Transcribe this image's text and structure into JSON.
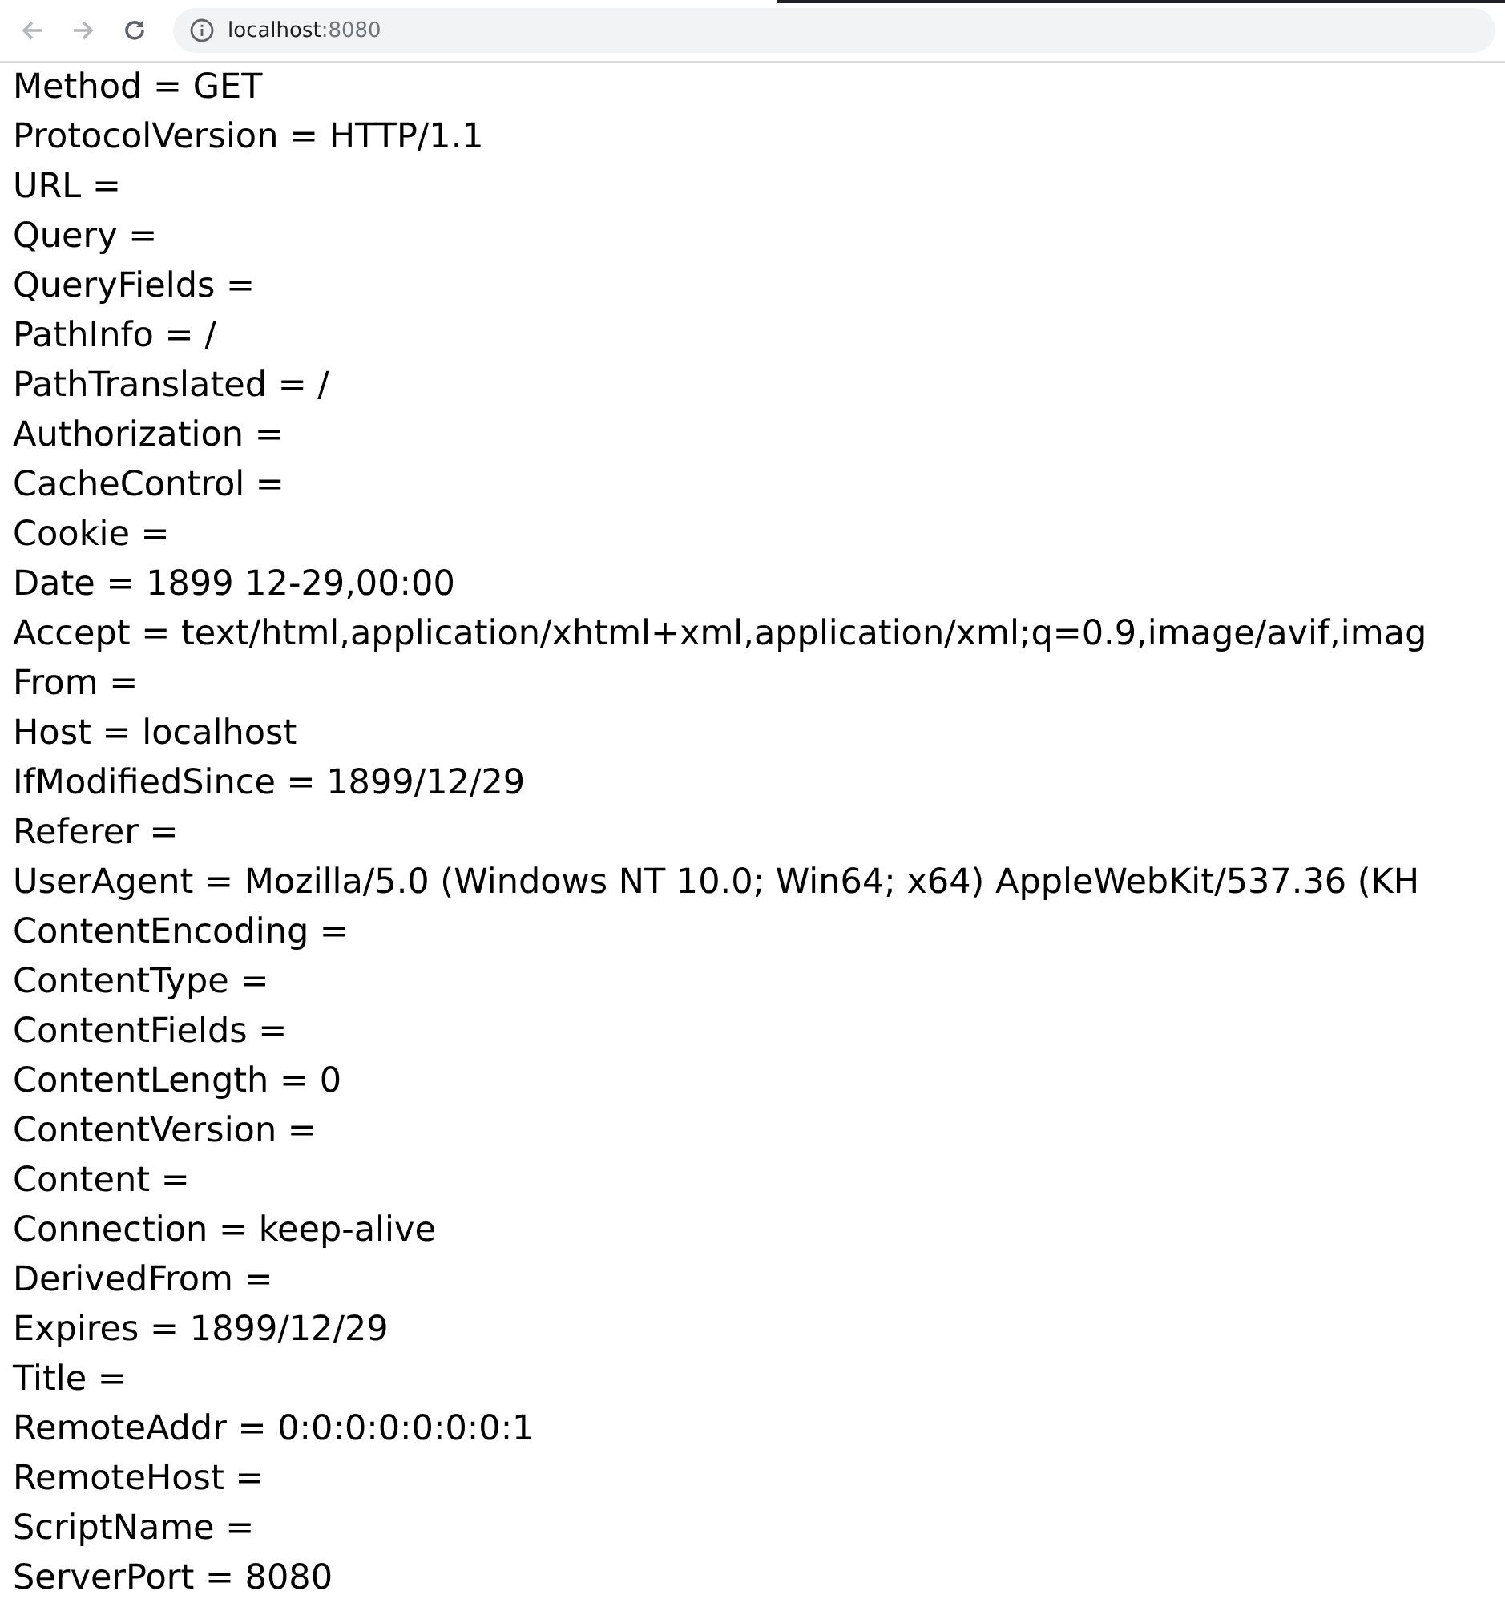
{
  "toolbar": {
    "back_disabled": true,
    "forward_disabled": true,
    "address": {
      "host": "localhost",
      "port": ":8080"
    }
  },
  "lines": [
    "Method = GET",
    "ProtocolVersion = HTTP/1.1",
    "URL =",
    "Query =",
    "QueryFields =",
    "PathInfo = /",
    "PathTranslated = /",
    "Authorization =",
    "CacheControl =",
    "Cookie =",
    "Date = 1899 12-29,00:00",
    "Accept = text/html,application/xhtml+xml,application/xml;q=0.9,image/avif,imag",
    "From =",
    "Host = localhost",
    "IfModifiedSince = 1899/12/29",
    "Referer =",
    "UserAgent = Mozilla/5.0 (Windows NT 10.0; Win64; x64) AppleWebKit/537.36 (KH",
    "ContentEncoding =",
    "ContentType =",
    "ContentFields =",
    "ContentLength = 0",
    "ContentVersion =",
    "Content =",
    "Connection = keep-alive",
    "DerivedFrom =",
    "Expires = 1899/12/29",
    "Title =",
    "RemoteAddr = 0:0:0:0:0:0:0:1",
    "RemoteHost =",
    "ScriptName =",
    "ServerPort = 8080"
  ]
}
